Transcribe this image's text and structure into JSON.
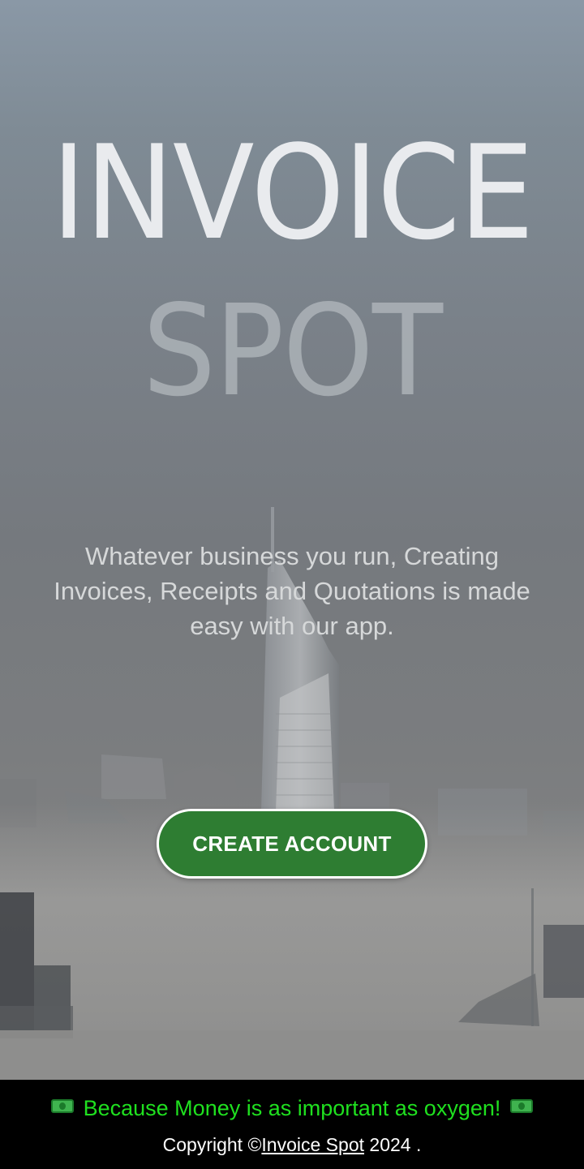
{
  "hero": {
    "title_line1": "INVOICE",
    "title_line2": "SPOT",
    "tagline": "Whatever business you run, Creating Invoices, Receipts and Quotations is made easy with our app.",
    "cta_label": "CREATE ACCOUNT"
  },
  "footer": {
    "slogan": "Because Money is as important as oxygen!",
    "copyright_prefix": "Copyright ©",
    "copyright_link": "Invoice Spot",
    "copyright_suffix": " 2024 ."
  },
  "icons": {
    "slogan_left": "money-bill-icon",
    "slogan_right": "money-bill-icon"
  },
  "colors": {
    "cta_background": "#2e7d32",
    "slogan_text": "#1fe01f",
    "footer_background": "#000000"
  }
}
